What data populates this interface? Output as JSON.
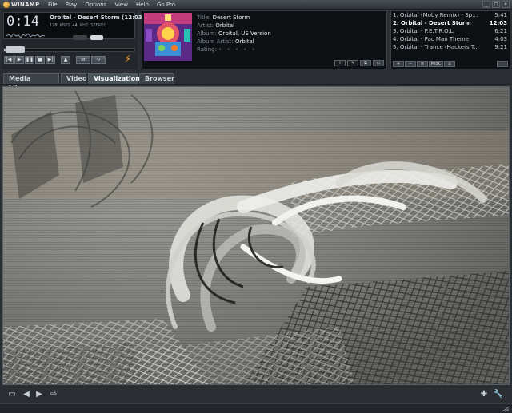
{
  "app": {
    "name": "WINAMP",
    "menu": [
      "File",
      "Play",
      "Options",
      "View",
      "Help",
      "Go Pro"
    ]
  },
  "player": {
    "time": "0:14",
    "track_display": "Orbital - Desert Storm (12:03)",
    "bitrate": "128",
    "bitrate_unit": "KBPS",
    "samplerate": "44",
    "samplerate_unit": "KHZ",
    "channels": "STEREO",
    "progress_fraction": 0.02,
    "transport": [
      "|◀",
      "▶",
      "❚❚",
      "■",
      "▶|"
    ],
    "eject": "▲",
    "shuffle": "⇄",
    "repeat": "↻"
  },
  "album": {
    "title_label": "Title:",
    "title": "Desert Storm",
    "artist_label": "Artist:",
    "artist": "Orbital",
    "album_label": "Album:",
    "album": "Orbital, US Version",
    "album_artist_label": "Album Artist:",
    "album_artist": "Orbital",
    "rating_label": "Rating:",
    "rating_stars": "• • • • •",
    "rating_value": 0
  },
  "playlist": {
    "items": [
      {
        "label": "1. Orbital (Moby Remix) - Spe...",
        "duration": "5:41",
        "active": false
      },
      {
        "label": "2. Orbital - Desert Storm",
        "duration": "12:03",
        "active": true
      },
      {
        "label": "3. Orbital - P.E.T.R.O.L",
        "duration": "6:21",
        "active": false
      },
      {
        "label": "4. Orbital - Pac Man Theme",
        "duration": "4:03",
        "active": false
      },
      {
        "label": "5. Orbital - Trance (Hackers T...",
        "duration": "9:21",
        "active": false
      }
    ],
    "buttons": [
      "+",
      "−",
      "≡",
      "MISC",
      "⌂"
    ]
  },
  "tabs": [
    {
      "label": "Media Library",
      "active": false
    },
    {
      "label": "Video",
      "active": false
    },
    {
      "label": "Visualization",
      "active": true
    },
    {
      "label": "Browser",
      "active": false
    }
  ],
  "bottom": {
    "buttons": [
      "▭",
      "◀",
      "▶",
      "⇨"
    ]
  }
}
